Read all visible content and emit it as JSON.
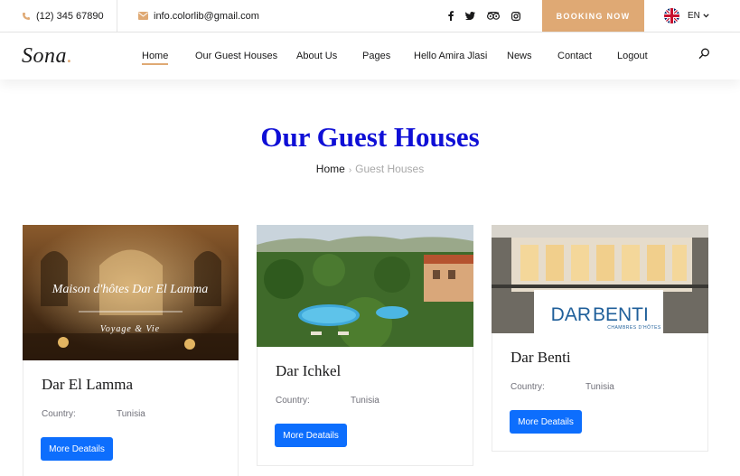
{
  "topbar": {
    "phone": "(12) 345 67890",
    "email": "info.colorlib@gmail.com",
    "social": [
      "facebook-icon",
      "twitter-icon",
      "tripadvisor-icon",
      "instagram-icon"
    ],
    "booking_label": "BOOKING NOW",
    "language": "EN"
  },
  "header": {
    "logo": "Sona",
    "logo_dot": ".",
    "nav": [
      {
        "label": "Home",
        "active": true
      },
      {
        "label": "Our Guest Houses"
      },
      {
        "label": "About Us"
      },
      {
        "label": "Pages"
      },
      {
        "label": "Hello Amira Jlasi"
      },
      {
        "label": "News"
      },
      {
        "label": "Contact"
      },
      {
        "label": "Logout"
      }
    ]
  },
  "page": {
    "title": "Our Guest Houses",
    "breadcrumb": {
      "home": "Home",
      "separator": "›",
      "current": "Guest Houses"
    }
  },
  "cards": [
    {
      "name": "Dar El Lamma",
      "country_label": "Country:",
      "country": "Tunisia",
      "button": "More Deatails",
      "image_text": {
        "title": "Maison d'hôtes Dar El Lamma",
        "subtitle": "Voyage & Vie"
      }
    },
    {
      "name": "Dar Ichkel",
      "country_label": "Country:",
      "country": "Tunisia",
      "button": "More Deatails"
    },
    {
      "name": "Dar Benti",
      "country_label": "Country:",
      "country": "Tunisia",
      "button": "More Deatails",
      "image_text": {
        "logo_left": "DAR",
        "logo_right": "BENTI",
        "logo_sub": "CHAMBRES D'HÔTES"
      }
    }
  ],
  "colors": {
    "accent": "#dfa974",
    "title_blue": "#0f0fd6",
    "button_blue": "#0d6efd"
  }
}
